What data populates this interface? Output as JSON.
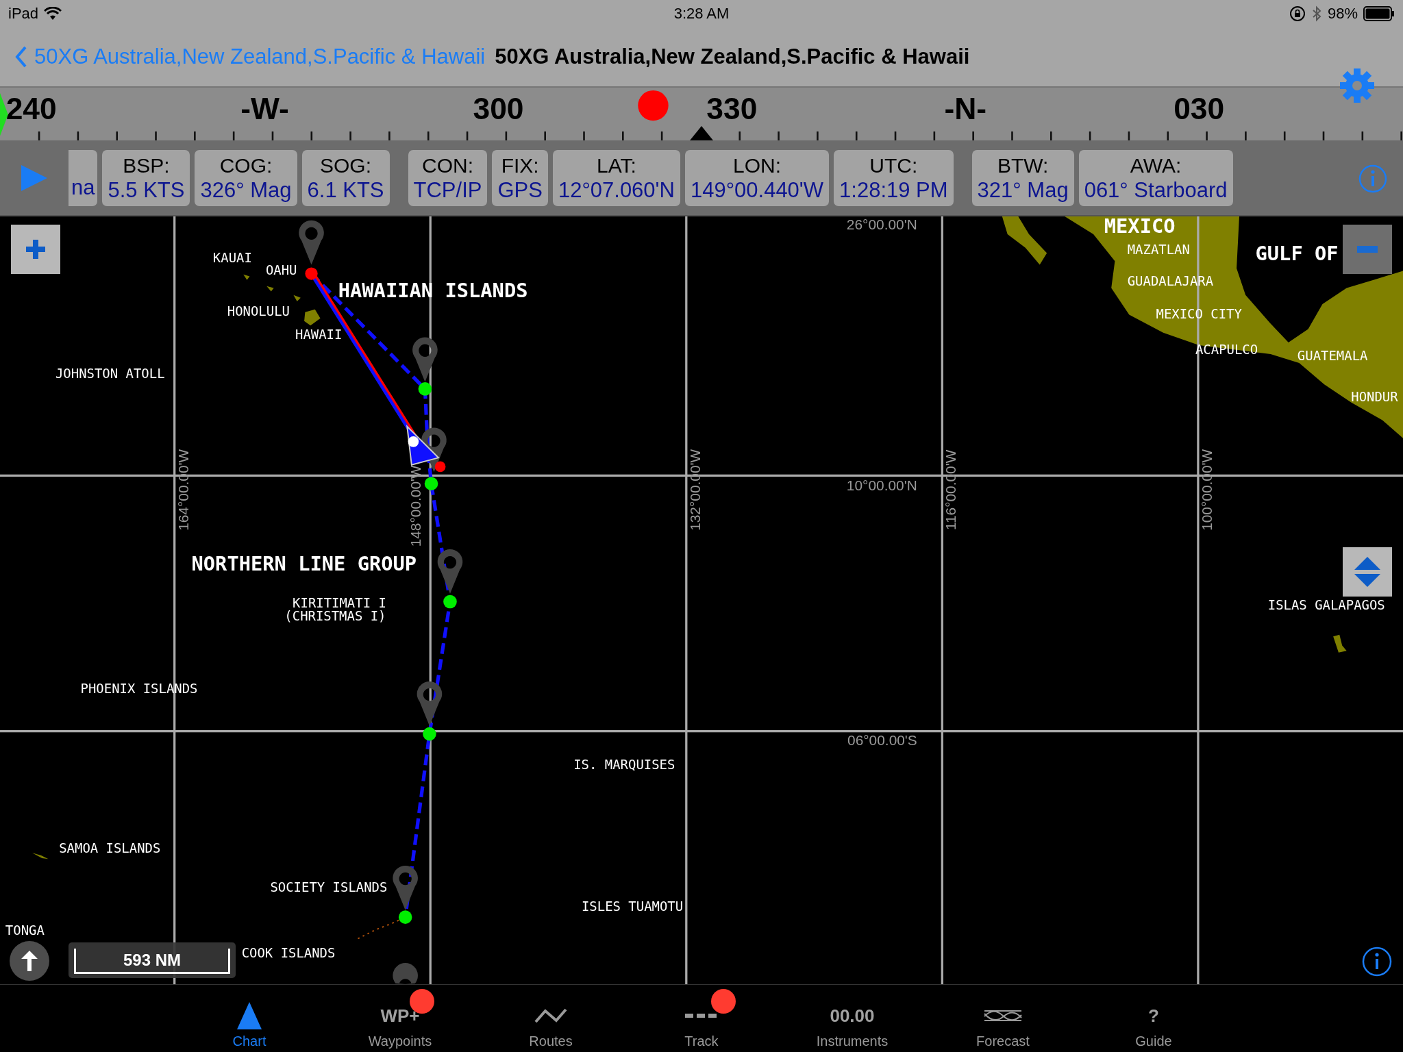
{
  "status_bar": {
    "device": "iPad",
    "time": "3:28 AM",
    "battery": "98%"
  },
  "nav": {
    "back_label": "50XG Australia,New Zealand,S.Pacific & Hawaii",
    "title": "50XG Australia,New Zealand,S.Pacific & Hawaii"
  },
  "compass": {
    "labels": [
      "240",
      "-W-",
      "300",
      "330",
      "-N-",
      "030"
    ]
  },
  "instruments": [
    {
      "value": "na"
    },
    {
      "label": "BSP:",
      "value": "5.5 KTS"
    },
    {
      "label": "COG:",
      "value": "326° Mag"
    },
    {
      "label": "SOG:",
      "value": "6.1 KTS"
    },
    {
      "label": "CON:",
      "value": "TCP/IP"
    },
    {
      "label": "FIX:",
      "value": "GPS"
    },
    {
      "label": "LAT:",
      "value": "12°07.060'N"
    },
    {
      "label": "LON:",
      "value": "149°00.440'W"
    },
    {
      "label": "UTC:",
      "value": "1:28:19 PM"
    },
    {
      "label": "BTW:",
      "value": "321° Mag"
    },
    {
      "label": "AWA:",
      "value": "061° Starboard"
    }
  ],
  "map": {
    "grid_labels": [
      {
        "text": "164°00.00'W",
        "kind": "meridian"
      },
      {
        "text": "148°00.00'W",
        "kind": "meridian"
      },
      {
        "text": "132°00.00'W",
        "kind": "meridian"
      },
      {
        "text": "116°00.00'W",
        "kind": "meridian"
      },
      {
        "text": "100°00.00'W",
        "kind": "meridian"
      },
      {
        "text": "26°00.00'N",
        "kind": "parallel"
      },
      {
        "text": "10°00.00'N",
        "kind": "parallel"
      },
      {
        "text": "06°00.00'S",
        "kind": "parallel"
      }
    ],
    "places": [
      {
        "text": "KAUAI",
        "kind": "minor"
      },
      {
        "text": "OAHU",
        "kind": "minor"
      },
      {
        "text": "HAWAIIAN ISLANDS",
        "kind": "major"
      },
      {
        "text": "HONOLULU",
        "kind": "minor"
      },
      {
        "text": "HAWAII",
        "kind": "minor"
      },
      {
        "text": "JOHNSTON ATOLL",
        "kind": "minor"
      },
      {
        "text": "MEXICO",
        "kind": "major"
      },
      {
        "text": "MAZATLAN",
        "kind": "minor"
      },
      {
        "text": "GULF OF",
        "kind": "major"
      },
      {
        "text": "GUADALAJARA",
        "kind": "minor"
      },
      {
        "text": "MEXICO CITY",
        "kind": "minor"
      },
      {
        "text": "ACAPULCO",
        "kind": "minor"
      },
      {
        "text": "GUATEMALA",
        "kind": "minor"
      },
      {
        "text": "HONDUR",
        "kind": "minor"
      },
      {
        "text": "NORTHERN LINE GROUP",
        "kind": "major"
      },
      {
        "text": "ISLAS GALAPAGOS",
        "kind": "minor"
      },
      {
        "text": "KIRITIMATI I",
        "kind": "minor"
      },
      {
        "text": "(CHRISTMAS I)",
        "kind": "minor"
      },
      {
        "text": "PHOENIX ISLANDS",
        "kind": "minor"
      },
      {
        "text": "IS. MARQUISES",
        "kind": "minor"
      },
      {
        "text": "SAMOA ISLANDS",
        "kind": "minor"
      },
      {
        "text": "SOCIETY ISLANDS",
        "kind": "minor"
      },
      {
        "text": "ISLES TUAMOTU",
        "kind": "minor"
      },
      {
        "text": "COOK ISLANDS",
        "kind": "minor"
      },
      {
        "text": "TONGA",
        "kind": "minor"
      }
    ],
    "scale": "593 NM"
  },
  "tabs": [
    {
      "label": "Chart",
      "kind": "triangle",
      "selected": true,
      "badge": false
    },
    {
      "label": "Waypoints",
      "kind": "text",
      "icon_text": "WP+",
      "selected": false,
      "badge": true
    },
    {
      "label": "Routes",
      "kind": "zigzag",
      "selected": false,
      "badge": false
    },
    {
      "label": "Track",
      "kind": "dashes",
      "selected": false,
      "badge": true
    },
    {
      "label": "Instruments",
      "kind": "text",
      "icon_text": "00.00",
      "selected": false,
      "badge": false
    },
    {
      "label": "Forecast",
      "kind": "waves",
      "selected": false,
      "badge": false
    },
    {
      "label": "Guide",
      "kind": "text",
      "icon_text": "?",
      "selected": false,
      "badge": false
    }
  ]
}
